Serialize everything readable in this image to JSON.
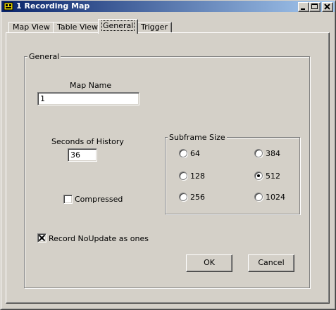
{
  "window": {
    "title": "1 Recording Map",
    "icon": "recording-map-app-icon",
    "controls": [
      "minimize-icon",
      "maximize-icon",
      "close-icon"
    ]
  },
  "tabs": [
    {
      "label": "Map View",
      "active": false
    },
    {
      "label": "Table View",
      "active": false
    },
    {
      "label": "General",
      "active": true
    },
    {
      "label": "Trigger",
      "active": false
    }
  ],
  "general_group": {
    "title": "General",
    "map_name": {
      "label": "Map Name",
      "value": "1"
    },
    "seconds_of_history": {
      "label": "Seconds of History",
      "value": "36"
    },
    "compressed": {
      "label": "Compressed",
      "checked": false
    },
    "record_noupdate": {
      "label": "Record NoUpdate as ones",
      "checked": true
    },
    "subframe": {
      "title": "Subframe Size",
      "options": [
        {
          "label": "64",
          "selected": false
        },
        {
          "label": "384",
          "selected": false
        },
        {
          "label": "128",
          "selected": false
        },
        {
          "label": "512",
          "selected": true
        },
        {
          "label": "256",
          "selected": false
        },
        {
          "label": "1024",
          "selected": false
        }
      ]
    }
  },
  "buttons": {
    "ok": "OK",
    "cancel": "Cancel"
  },
  "colors": {
    "face": "#d4d0c8",
    "title_start": "#0a246a",
    "title_end": "#a6caf0"
  }
}
